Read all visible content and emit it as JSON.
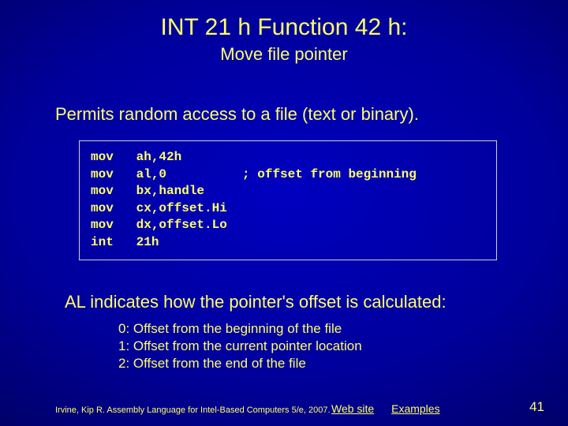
{
  "title": "INT 21 h Function 42 h:",
  "subtitle": "Move file pointer",
  "intro": "Permits random access to a file (text or binary).",
  "code": "mov   ah,42h\nmov   al,0          ; offset from beginning\nmov   bx,handle\nmov   cx,offset.Hi\nmov   dx,offset.Lo\nint   21h",
  "after": "AL indicates how the pointer's offset is calculated:",
  "list": {
    "l0": "0:  Offset from the beginning of the file",
    "l1": "1:  Offset from the current pointer location",
    "l2": "2:  Offset from the end of the file"
  },
  "footer": {
    "citation": "Irvine, Kip R. Assembly Language for Intel-Based Computers 5/e, 2007.",
    "link1": "Web site",
    "link2": "Examples",
    "page": "41"
  }
}
